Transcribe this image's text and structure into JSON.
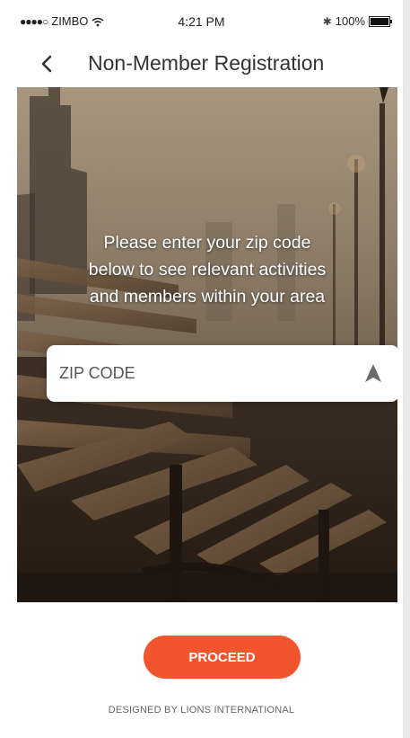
{
  "status_bar": {
    "signal_dots": "●●●●○",
    "carrier": "ZIMBO",
    "time": "4:21 PM",
    "battery_percent": "100%",
    "icons": [
      "wifi-icon",
      "bluetooth-icon",
      "battery-icon"
    ]
  },
  "nav": {
    "back_icon": "chevron-left-icon",
    "title": "Non-Member Registration"
  },
  "hero": {
    "background": "park-bench-at-dusk-photo",
    "message_line1": "Please enter your zip code",
    "message_line2": "below to see relevant activities",
    "message_line3": "and members within your area",
    "zip_placeholder": "ZIP CODE",
    "zip_value": "",
    "location_icon": "navigation-arrow-icon"
  },
  "actions": {
    "proceed_label": "PROCEED"
  },
  "footer": {
    "text": "DESIGNED BY LIONS INTERNATIONAL"
  },
  "colors": {
    "accent": "#f2542d",
    "title_text": "#333333",
    "footer_text": "#666666"
  }
}
